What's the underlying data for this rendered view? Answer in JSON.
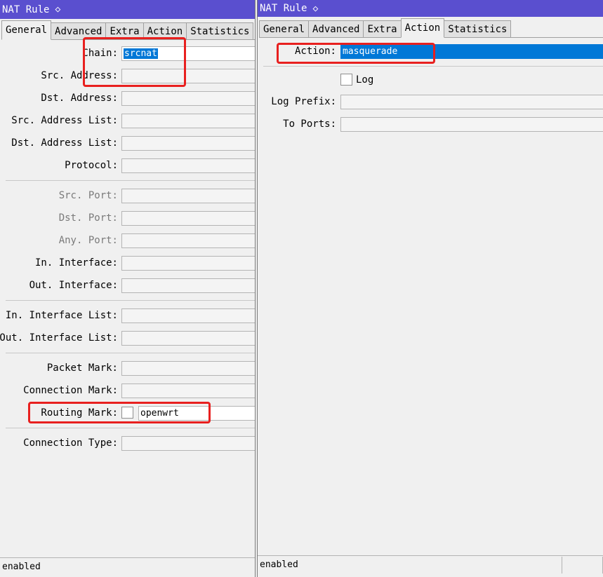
{
  "left": {
    "title": "NAT Rule",
    "title_icon": "◇",
    "tabs": [
      "General",
      "Advanced",
      "Extra",
      "Action",
      "Statistics"
    ],
    "active_tab": "General",
    "chain_label": "Chain:",
    "chain_value": "srcnat",
    "src_address_label": "Src. Address:",
    "dst_address_label": "Dst. Address:",
    "src_address_list_label": "Src. Address List:",
    "dst_address_list_label": "Dst. Address List:",
    "protocol_label": "Protocol:",
    "src_port_label": "Src. Port:",
    "dst_port_label": "Dst. Port:",
    "any_port_label": "Any. Port:",
    "in_interface_label": "In. Interface:",
    "out_interface_label": "Out. Interface:",
    "in_interface_list_label": "In. Interface List:",
    "out_interface_list_label": "Out. Interface List:",
    "packet_mark_label": "Packet Mark:",
    "connection_mark_label": "Connection Mark:",
    "routing_mark_label": "Routing Mark:",
    "routing_mark_value": "openwrt",
    "connection_type_label": "Connection Type:",
    "status": "enabled"
  },
  "right": {
    "title": "NAT Rule",
    "title_icon": "◇",
    "tabs": [
      "General",
      "Advanced",
      "Extra",
      "Action",
      "Statistics"
    ],
    "active_tab": "Action",
    "action_label": "Action:",
    "action_value": "masquerade",
    "log_label": "Log",
    "log_prefix_label": "Log Prefix:",
    "to_ports_label": "To Ports:",
    "status": "enabled"
  },
  "colors": {
    "titlebar": "#5a4fcf",
    "selection": "#0078d7",
    "highlight": "#e8201f"
  }
}
